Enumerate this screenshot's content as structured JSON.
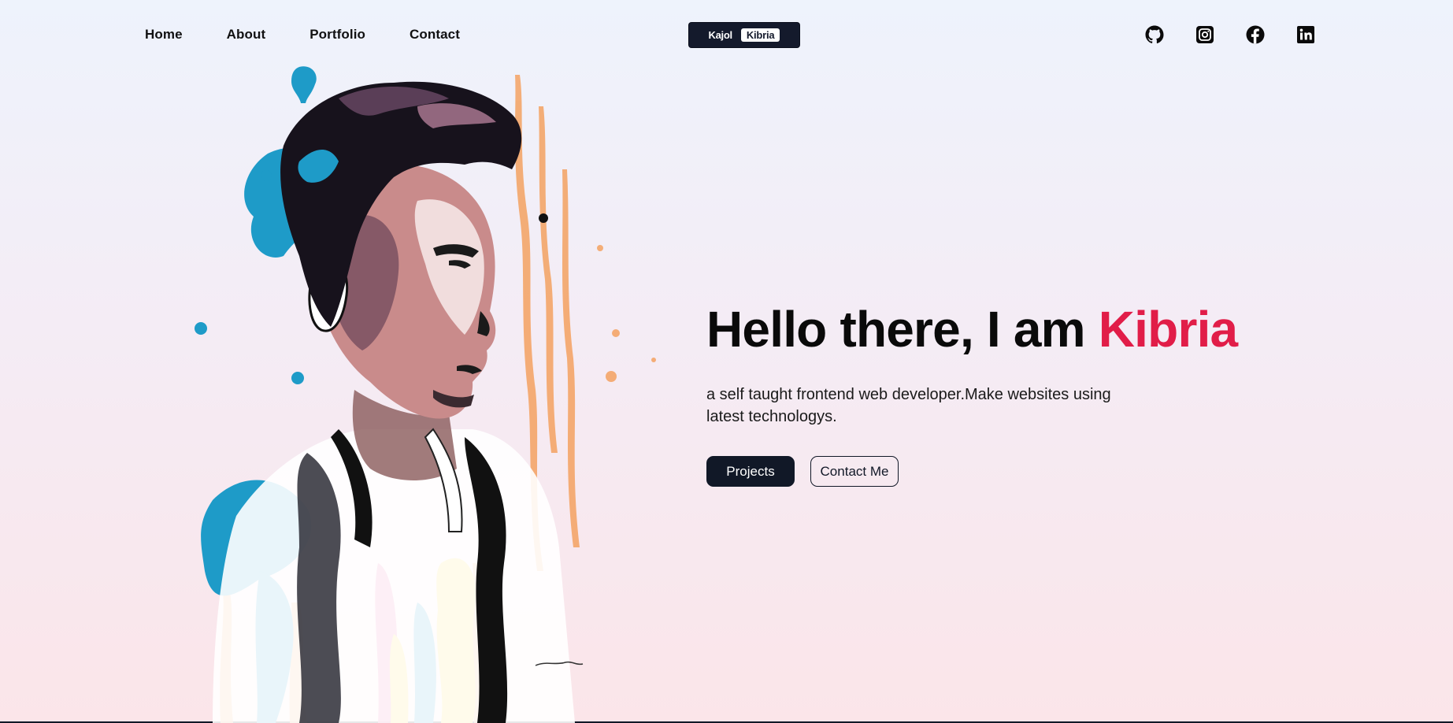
{
  "nav": {
    "links": [
      {
        "label": "Home"
      },
      {
        "label": "About"
      },
      {
        "label": "Portfolio"
      },
      {
        "label": "Contact"
      }
    ]
  },
  "logo": {
    "first": "Kajol",
    "second": "Kibria"
  },
  "socials": [
    {
      "icon": "github-icon"
    },
    {
      "icon": "instagram-icon"
    },
    {
      "icon": "facebook-icon"
    },
    {
      "icon": "linkedin-icon"
    }
  ],
  "hero": {
    "title_prefix": "Hello there, I am",
    "title_name": "Kibria",
    "subtitle": "a self taught frontend web developer.Make websites using latest technologys.",
    "primary_button": "Projects",
    "secondary_button": "Contact Me"
  },
  "colors": {
    "accent": "#e11d48",
    "dark": "#111827",
    "background_top": "#eef3fc",
    "background_bottom": "#fbe5e9"
  }
}
